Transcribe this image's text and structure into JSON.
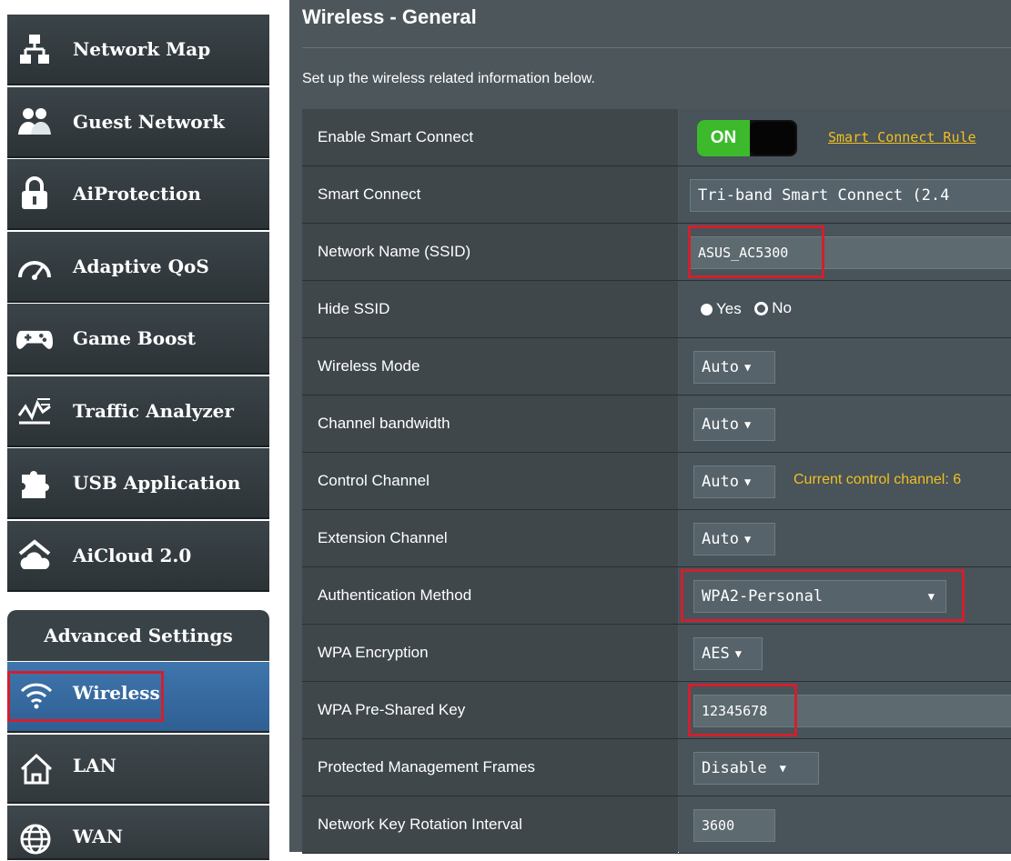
{
  "sidebar": {
    "items": [
      {
        "label": "Network Map"
      },
      {
        "label": "Guest Network"
      },
      {
        "label": "AiProtection"
      },
      {
        "label": "Adaptive QoS"
      },
      {
        "label": "Game Boost"
      },
      {
        "label": "Traffic Analyzer"
      },
      {
        "label": "USB Application"
      },
      {
        "label": "AiCloud 2.0"
      }
    ],
    "advanced_header": "Advanced Settings",
    "advanced_items": [
      {
        "label": "Wireless"
      },
      {
        "label": "LAN"
      },
      {
        "label": "WAN"
      }
    ]
  },
  "main": {
    "title": "Wireless - General",
    "subtitle": "Set up the wireless related information below.",
    "rows": {
      "smart_connect_enable": {
        "label": "Enable Smart Connect",
        "toggle": "ON",
        "link": "Smart Connect Rule"
      },
      "smart_connect": {
        "label": "Smart Connect",
        "value": "Tri-band Smart Connect (2.4"
      },
      "ssid": {
        "label": "Network Name (SSID)",
        "value": "ASUS_AC5300"
      },
      "hide_ssid": {
        "label": "Hide SSID",
        "yes": "Yes",
        "no": "No"
      },
      "wireless_mode": {
        "label": "Wireless Mode",
        "value": "Auto"
      },
      "channel_bandwidth": {
        "label": "Channel bandwidth",
        "value": "Auto"
      },
      "control_channel": {
        "label": "Control Channel",
        "value": "Auto",
        "hint": "Current control channel: 6"
      },
      "extension_channel": {
        "label": "Extension Channel",
        "value": "Auto"
      },
      "auth_method": {
        "label": "Authentication Method",
        "value": "WPA2-Personal"
      },
      "wpa_encryption": {
        "label": "WPA Encryption",
        "value": "AES"
      },
      "psk": {
        "label": "WPA Pre-Shared Key",
        "value": "12345678"
      },
      "pmf": {
        "label": "Protected Management Frames",
        "value": "Disable"
      },
      "key_rotation": {
        "label": "Network Key Rotation Interval",
        "value": "3600"
      }
    }
  },
  "colors": {
    "accent_green": "#3dba2b",
    "highlight_red": "#d0202e",
    "link_yellow": "#f0c020",
    "active_blue": "#3f76ad"
  }
}
